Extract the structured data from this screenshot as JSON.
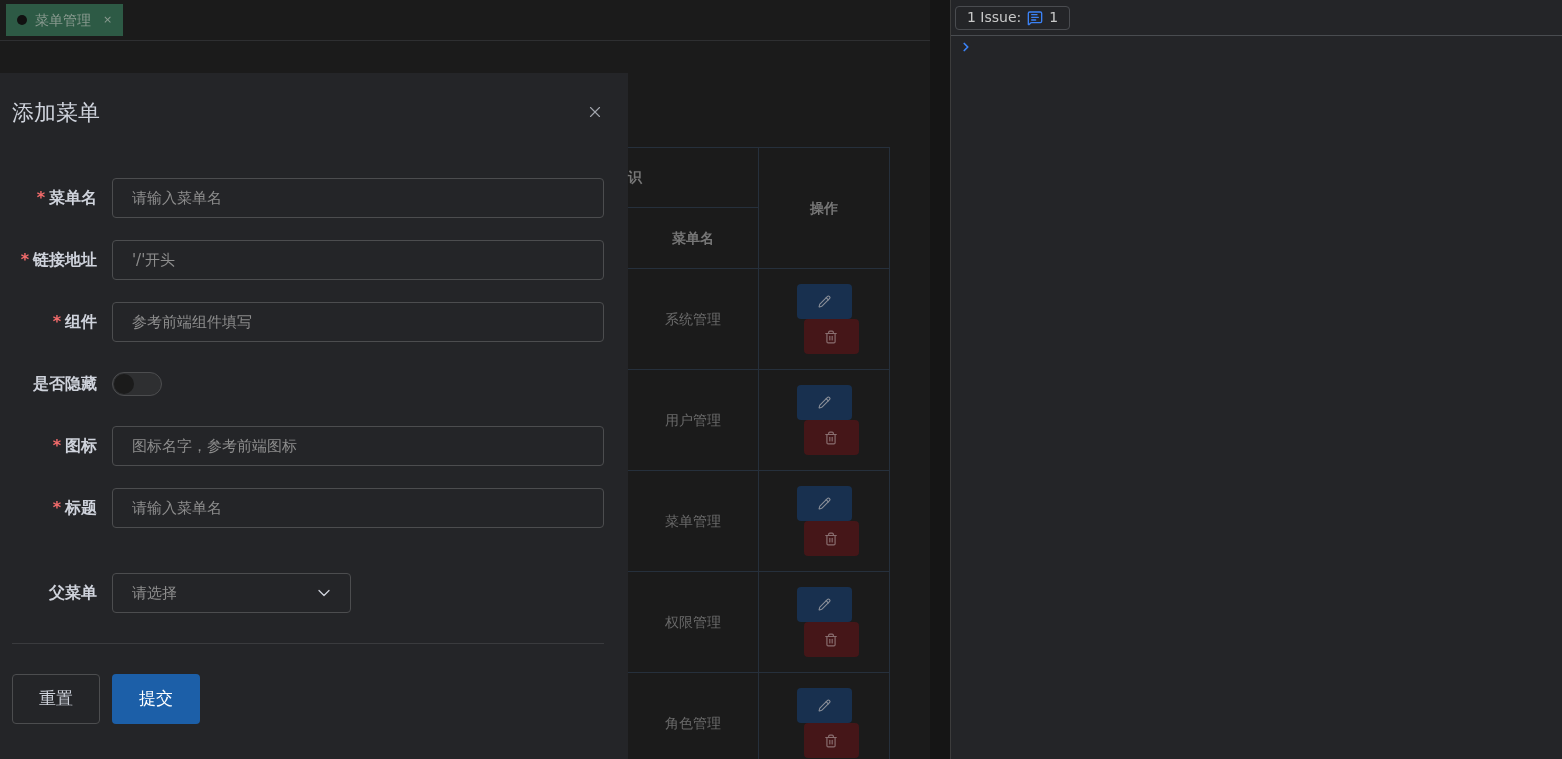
{
  "tabs": [
    {
      "label": "菜单管理",
      "close": "×",
      "selected": true
    }
  ],
  "drawer": {
    "title": "添加菜单",
    "fields": [
      {
        "kind": "input",
        "required_mark": "*",
        "label": "菜单名",
        "placeholder": "请输入菜单名"
      },
      {
        "kind": "input",
        "required_mark": "*",
        "label": "链接地址",
        "placeholder": "'/'开头"
      },
      {
        "kind": "input",
        "required_mark": "*",
        "label": "组件",
        "placeholder": "参考前端组件填写"
      },
      {
        "kind": "switch",
        "label": "是否隐藏",
        "on": false
      },
      {
        "kind": "input",
        "required_mark": "*",
        "label": "图标",
        "placeholder": "图标名字，参考前端图标"
      },
      {
        "kind": "input",
        "required_mark": "*",
        "label": "标题",
        "placeholder": "请输入菜单名"
      },
      {
        "kind": "select",
        "label": "父菜单",
        "placeholder": "请选择"
      }
    ],
    "buttons": [
      {
        "label": "重置",
        "kind": "default"
      },
      {
        "label": "提交",
        "kind": "primary"
      }
    ]
  },
  "table": {
    "group_header": "识",
    "columns": [
      "菜单名",
      "操作"
    ],
    "rows": [
      {
        "name": "系统管理"
      },
      {
        "name": "用户管理"
      },
      {
        "name": "菜单管理"
      },
      {
        "name": "权限管理"
      },
      {
        "name": "角色管理"
      }
    ]
  },
  "devtools": {
    "issues_label": "1 Issue:",
    "issues_count": "1"
  }
}
